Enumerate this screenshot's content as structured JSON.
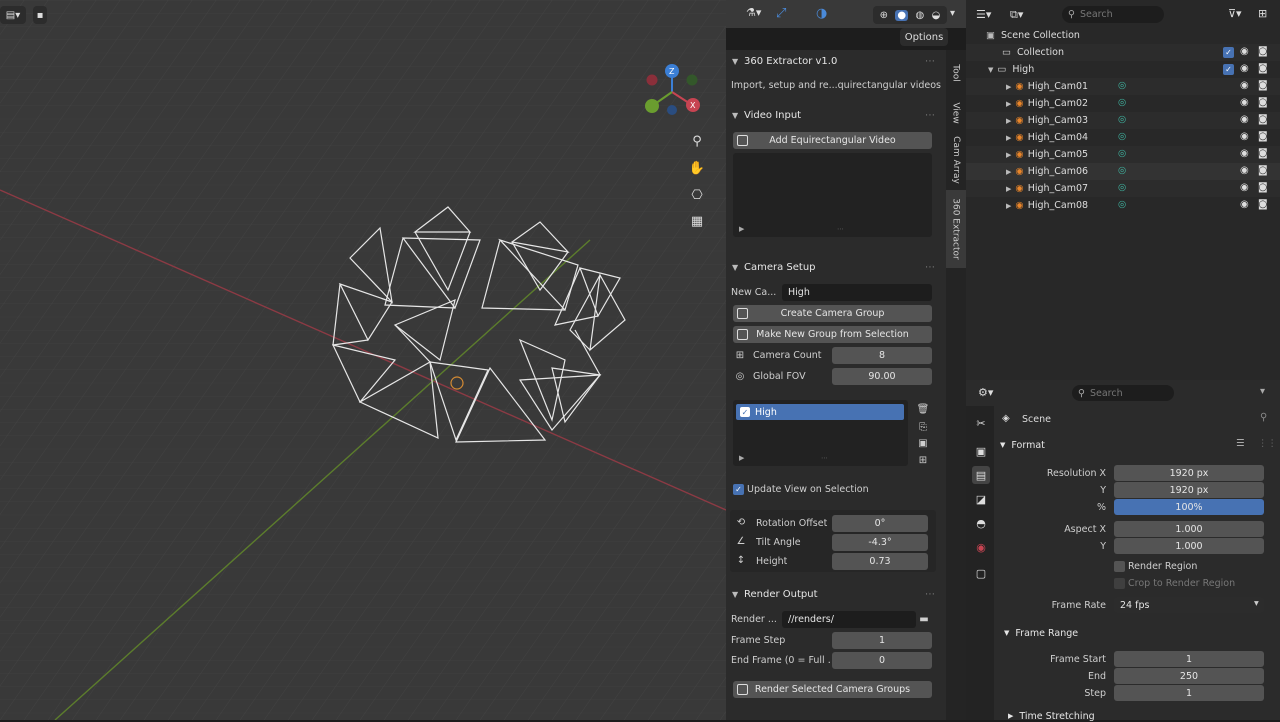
{
  "header": {
    "options_label": "Options"
  },
  "npanel": {
    "addon": {
      "title": "360 Extractor v1.0",
      "description": "Import, setup and re...quirectangular videos"
    },
    "video_input": {
      "title": "Video Input",
      "add_button": "Add Equirectangular Video"
    },
    "camera_setup": {
      "title": "Camera Setup",
      "new_camera_label": "New Ca...",
      "new_camera_value": "High",
      "create_group_button": "Create Camera Group",
      "make_group_button": "Make New Group from Selection",
      "camera_count_label": "Camera Count",
      "camera_count_value": "8",
      "global_fov_label": "Global FOV",
      "global_fov_value": "90.00",
      "groups": [
        {
          "name": "High",
          "checked": true
        }
      ],
      "update_view_label": "Update View on Selection",
      "update_view_checked": true,
      "rotation_offset_label": "Rotation Offset",
      "rotation_offset_value": "0°",
      "tilt_angle_label": "Tilt Angle",
      "tilt_angle_value": "-4.3°",
      "height_label": "Height",
      "height_value": "0.73"
    },
    "render_output": {
      "title": "Render Output",
      "render_label": "Render ...",
      "render_path": "//renders/",
      "frame_step_label": "Frame Step",
      "frame_step_value": "1",
      "end_frame_label": "End Frame (0 = Full ...",
      "end_frame_value": "0",
      "render_button": "Render Selected Camera Groups"
    }
  },
  "side_tabs": [
    "Tool",
    "View",
    "Cam Array",
    "360 Extractor"
  ],
  "outliner": {
    "search_placeholder": "Search",
    "scene_collection": "Scene Collection",
    "collection": "Collection",
    "group": "High",
    "cameras": [
      "High_Cam01",
      "High_Cam02",
      "High_Cam03",
      "High_Cam04",
      "High_Cam05",
      "High_Cam06",
      "High_Cam07",
      "High_Cam08"
    ]
  },
  "properties": {
    "search_placeholder": "Search",
    "context_label": "Scene",
    "format_title": "Format",
    "resolution_x_label": "Resolution X",
    "resolution_x_value": "1920 px",
    "resolution_y_label": "Y",
    "resolution_y_value": "1920 px",
    "percent_label": "%",
    "percent_value": "100%",
    "aspect_x_label": "Aspect X",
    "aspect_x_value": "1.000",
    "aspect_y_label": "Y",
    "aspect_y_value": "1.000",
    "render_region_label": "Render Region",
    "crop_region_label": "Crop to Render Region",
    "frame_rate_label": "Frame Rate",
    "frame_rate_value": "24 fps",
    "frame_range_title": "Frame Range",
    "frame_start_label": "Frame Start",
    "frame_start_value": "1",
    "end_label": "End",
    "end_value": "250",
    "step_label": "Step",
    "step_value": "1",
    "time_stretching_title": "Time Stretching"
  },
  "colors": {
    "accent": "#4772b3",
    "camera_orange": "#e8852a",
    "camera_data_teal": "#3fb4a0",
    "x_axis_red": "#c74452",
    "y_axis_green": "#6a9d2f",
    "z_axis_blue": "#3b7fd6"
  }
}
